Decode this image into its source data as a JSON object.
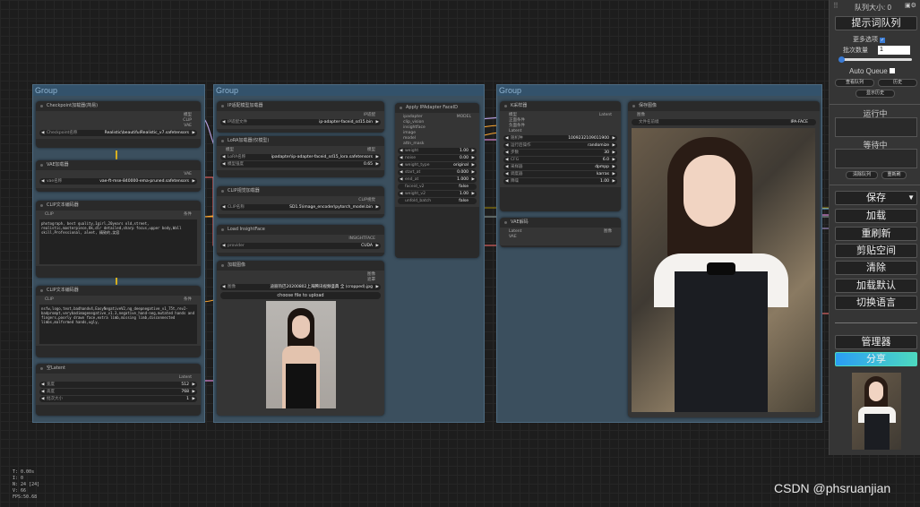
{
  "groups": [
    {
      "title": "Group"
    },
    {
      "title": "Group"
    },
    {
      "title": "Group"
    }
  ],
  "nodes": {
    "checkpoint": {
      "title": "Checkpoint加载器(简易)",
      "outputs": [
        "模型",
        "CLIP",
        "VAE"
      ],
      "widget_name": "Checkpoint名称",
      "widget_value": "Realistic\\beautifulRealistic_v7.safetensors"
    },
    "vae_loader": {
      "title": "VAE加载器",
      "outputs": [
        "VAE"
      ],
      "widget_name": "vae名称",
      "widget_value": "vae-ft-mse-840000-ema-pruned.safetensors"
    },
    "clip_text_pos": {
      "title": "CLIP文本编码器",
      "input": "CLIP",
      "output": "条件",
      "text": "photograph, best quality,1girl,20years old,street,\nrealistic,masterpiece,8k,dlr detailed,sharp focus,upper body,Wall\nskill,Professional, aleet, 精致的,笑容"
    },
    "clip_text_neg": {
      "title": "CLIP文本编码器",
      "input": "CLIP",
      "output": "条件",
      "text": "nsfw,logo,text,badhandv4,EasyNegativeV2,ng_deepnegative_v1_75t,rev2-\nbadprompt,verybadimagenegative_v1.3,negative_hand-neg,mutated hands and\nfingers,poorly drawn face,extra limb,missing limb,disconnected\nlimbs,malformed hands,ugly,"
    },
    "empty_latent": {
      "title": "空Latent",
      "output": "Latent",
      "widgets": [
        {
          "name": "宽度",
          "value": "512"
        },
        {
          "name": "高度",
          "value": "768"
        },
        {
          "name": "批次大小",
          "value": "1"
        }
      ]
    },
    "ipadapter_loader": {
      "title": "IP适配模型加载器",
      "output": "IP适配",
      "widget_name": "IP适配文件",
      "widget_value": "ip-adapter-faceid_sd15.bin"
    },
    "lora_loader": {
      "title": "LoRA加载器(仅模型)",
      "input": "模型",
      "output": "模型",
      "widgets": [
        {
          "name": "LoRA名称",
          "value": "ipadapter\\ip-adapter-faceid_sd15_lora.safetensors"
        },
        {
          "name": "模型强度",
          "value": "0.65"
        }
      ]
    },
    "clip_vision": {
      "title": "CLIP视觉加载器",
      "output": "CLIP视觉",
      "widget_name": "CLIP名称",
      "widget_value": "SD1.5\\image_encoder\\pytorch_model.bin"
    },
    "insightface": {
      "title": "Load InsightFace",
      "output": "INSIGHTFACE",
      "widget_name": "provider",
      "widget_value": "CUDA"
    },
    "load_image": {
      "title": "加载图像",
      "outputs": [
        "图像",
        "遮罩"
      ],
      "widget_name": "图像",
      "widget_value": "迪丽热巴20200802上海腾讯视频盛典 全 (cropped).jpg",
      "upload_label": "choose file to upload"
    },
    "apply_ipadapter": {
      "title": "Apply IPAdapter FaceID",
      "inputs": [
        "ipadapter",
        "clip_vision",
        "insightface",
        "image",
        "model",
        "attn_mask"
      ],
      "output": "MODEL",
      "widgets": [
        {
          "name": "weight",
          "value": "1.00"
        },
        {
          "name": "noise",
          "value": "0.00"
        },
        {
          "name": "weight_type",
          "value": "original"
        },
        {
          "name": "start_at",
          "value": "0.000"
        },
        {
          "name": "end_at",
          "value": "1.000"
        },
        {
          "name": "faceid_v2",
          "value": "false"
        },
        {
          "name": "weight_v2",
          "value": "1.00"
        },
        {
          "name": "unfold_batch",
          "value": "false"
        }
      ]
    },
    "ksampler": {
      "title": "K采样器",
      "inputs": [
        "模型",
        "正面条件",
        "负面条件",
        "Latent"
      ],
      "output": "Latent",
      "widgets": [
        {
          "name": "随机种",
          "value": "1009232109011900"
        },
        {
          "name": "运行后操作",
          "value": "randomize"
        },
        {
          "name": "步数",
          "value": "30"
        },
        {
          "name": "CFG",
          "value": "6.0"
        },
        {
          "name": "采样器",
          "value": "dpmpp"
        },
        {
          "name": "调度器",
          "value": "karras"
        },
        {
          "name": "降噪",
          "value": "1.00"
        }
      ]
    },
    "vae_decode": {
      "title": "VAE解码",
      "inputs": [
        "Latent",
        "VAE"
      ],
      "output": "图像"
    },
    "save_image": {
      "title": "保存图像",
      "input": "图像",
      "widget_name": "文件名前缀",
      "widget_value": "IPA-FACE"
    }
  },
  "panel": {
    "queue_size": "队列大小: 0",
    "queue_prompt": "提示词队列",
    "extra_options": "更多选项",
    "batch_label": "批次数量",
    "batch_value": "1",
    "auto_queue": "Auto Queue",
    "small_btns": [
      "查看队列",
      "历史",
      "显示历史"
    ],
    "running": "运行中",
    "pending": "等待中",
    "clear_queue": "清除队列",
    "refresh": "重新刷",
    "save": "保存",
    "load": "加载",
    "refresh_btn": "重刷新",
    "clipspace": "剪贴空间",
    "clear": "清除",
    "load_default": "加载默认",
    "switch_lang": "切换语言",
    "manager": "管理器",
    "share": "分享"
  },
  "stats": [
    "T: 0.00s",
    "I: 0",
    "N: 24 [24]",
    "V: 66",
    "FPS:50.68"
  ],
  "watermark": "CSDN @phsruanjian",
  "colors": {
    "model_link": "#b39ddb",
    "clip_link": "#ffd500",
    "vae_link": "#ff6e6e",
    "cond_link": "#ffa931",
    "latent_link": "#ff9cf9",
    "image_link": "#64b5f6",
    "share_gradient": "#4dd9c0"
  }
}
